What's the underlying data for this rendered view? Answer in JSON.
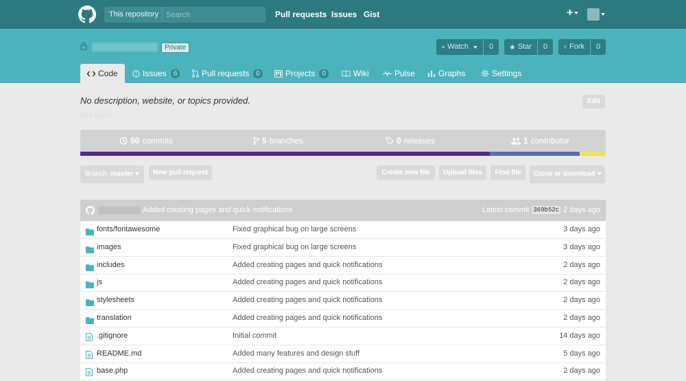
{
  "header": {
    "search_scope": "This repository",
    "search_placeholder": "Search",
    "nav": {
      "pull_requests": "Pull requests",
      "issues": "Issues",
      "gist": "Gist"
    },
    "new_menu": "+"
  },
  "repo": {
    "visibility": "Private",
    "watch": {
      "label": "Watch",
      "count": "0"
    },
    "star": {
      "label": "Star",
      "count": "0"
    },
    "fork": {
      "label": "Fork",
      "count": "0"
    }
  },
  "tabs": [
    {
      "label": "Code",
      "icon": "code-icon",
      "active": true
    },
    {
      "label": "Issues",
      "count": "6",
      "icon": "issue-icon"
    },
    {
      "label": "Pull requests",
      "count": "0",
      "icon": "pull-request-icon"
    },
    {
      "label": "Projects",
      "count": "0",
      "icon": "project-icon"
    },
    {
      "label": "Wiki",
      "icon": "wiki-icon"
    },
    {
      "label": "Pulse",
      "icon": "pulse-icon"
    },
    {
      "label": "Graphs",
      "icon": "graph-icon"
    },
    {
      "label": "Settings",
      "icon": "gear-icon"
    }
  ],
  "description": {
    "text": "No description, website, or topics provided.",
    "add_topics": "Add topics",
    "edit_label": "Edit"
  },
  "stats": {
    "commits": {
      "count": "50",
      "label": "commits"
    },
    "branches": {
      "count": "5",
      "label": "branches"
    },
    "releases": {
      "count": "0",
      "label": "releases"
    },
    "contributors": {
      "count": "1",
      "label": "contributor"
    }
  },
  "languages": [
    {
      "color": "#4f2b89",
      "share": 0.78
    },
    {
      "color": "#5a6bb0",
      "share": 0.17
    },
    {
      "color": "#f1e05a",
      "share": 0.05
    }
  ],
  "toolbar": {
    "branch_label": "Branch:",
    "branch_value": "master",
    "new_pull_request": "New pull request",
    "create_new_file": "Create new file",
    "upload_files": "Upload files",
    "find_file": "Find file",
    "clone_or_download": "Clone or download"
  },
  "latest_commit": {
    "message": "Added creating pages and quick notifications",
    "label": "Latest commit",
    "sha": "369b52c",
    "age": "2 days ago"
  },
  "files": [
    {
      "type": "dir",
      "name": "fonts/",
      "name_suffix": "fontawesome",
      "message": "Fixed graphical bug on large screens",
      "age": "3 days ago"
    },
    {
      "type": "dir",
      "name": "images",
      "message": "Fixed graphical bug on large screens",
      "age": "3 days ago"
    },
    {
      "type": "dir",
      "name": "includes",
      "message": "Added creating pages and quick notifications",
      "age": "2 days ago"
    },
    {
      "type": "dir",
      "name": "js",
      "message": "Added creating pages and quick notifications",
      "age": "2 days ago"
    },
    {
      "type": "dir",
      "name": "stylesheets",
      "message": "Added creating pages and quick notifications",
      "age": "2 days ago"
    },
    {
      "type": "dir",
      "name": "translation",
      "message": "Added creating pages and quick notifications",
      "age": "2 days ago"
    },
    {
      "type": "file",
      "name": ".gitignore",
      "message": "Initial commit",
      "age": "14 days ago"
    },
    {
      "type": "file",
      "name": "README.md",
      "message": "Added many features and design stuff",
      "age": "5 days ago"
    },
    {
      "type": "file",
      "name": "base.php",
      "message": "Added creating pages and quick notifications",
      "age": "2 days ago"
    }
  ]
}
